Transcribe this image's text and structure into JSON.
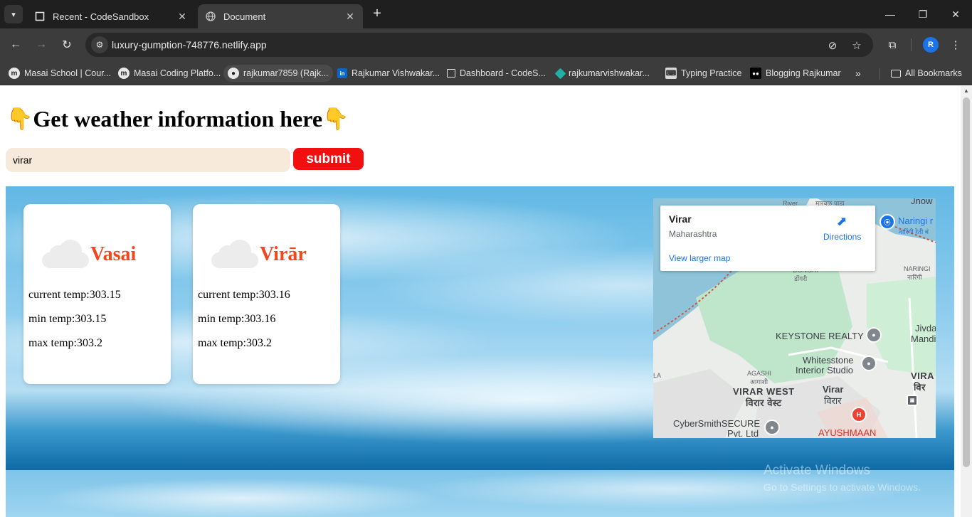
{
  "browser": {
    "tabs": [
      {
        "title": "Recent - CodeSandbox",
        "active": false
      },
      {
        "title": "Document",
        "active": true
      }
    ],
    "url": "luxury-gumption-748776.netlify.app",
    "profile_initial": "R",
    "bookmarks": [
      {
        "label": "Masai School | Cour...",
        "icon": "masai-icon"
      },
      {
        "label": "Masai Coding Platfo...",
        "icon": "masai-icon"
      },
      {
        "label": "rajkumar7859 (Rajk...",
        "icon": "github-icon"
      },
      {
        "label": "Rajkumar Vishwakar...",
        "icon": "linkedin-icon"
      },
      {
        "label": "Dashboard - CodeS...",
        "icon": "codesandbox-icon"
      },
      {
        "label": "rajkumarvishwakar...",
        "icon": "diamond-icon"
      },
      {
        "label": "Typing Practice",
        "icon": "typing-icon"
      },
      {
        "label": "Blogging Rajkumar",
        "icon": "medium-icon"
      }
    ],
    "all_bookmarks_label": "All Bookmarks"
  },
  "page": {
    "heading": "Get weather information here",
    "heading_emoji": "👇",
    "search_value": "virar",
    "submit_label": "submit",
    "cards": [
      {
        "city": "Vasai",
        "current": "current temp:303.15",
        "min": "min temp:303.15",
        "max": "max temp:303.2"
      },
      {
        "city": "Virār",
        "current": "current temp:303.16",
        "min": "min temp:303.16",
        "max": "max temp:303.2"
      }
    ],
    "map": {
      "place_title": "Virar",
      "place_sub": "Maharashtra",
      "directions_label": "Directions",
      "larger_map_label": "View larger map",
      "labels": {
        "top_marathi": "मारबळ पाडा",
        "top_river": "River",
        "snow": "Jnow",
        "naringi": "Naringi r",
        "naringi_marathi": "नारिंगी रेती बं",
        "naringi_small": "NARINGI",
        "naringi_small_marathi": "नारिंगी",
        "dongri": "DONGRI",
        "dongri_marathi": "डोंगरी",
        "keystone": "KEYSTONE REALTY",
        "jivdani": "Jivda",
        "mandir": "Mandir",
        "whitestone1": "Whitesstone",
        "whitestone2": "Interior Studio",
        "agashi": "AGASHI",
        "agashi_marathi": "आगाशी",
        "virar_west": "VIRAR WEST",
        "virar_west_marathi": "विरार वेस्ट",
        "virar": "Virar",
        "virar_marathi": "विरार",
        "virar_east": "VIRA",
        "virar_east_marathi": "विर",
        "la": "LA",
        "cyber1": "CyberSmithSECURE",
        "cyber2": "Pvt. Ltd",
        "ayushmaan": "AYUSHMAAN"
      }
    },
    "watermark": {
      "title": "Activate Windows",
      "subtitle": "Go to Settings to activate Windows."
    }
  }
}
